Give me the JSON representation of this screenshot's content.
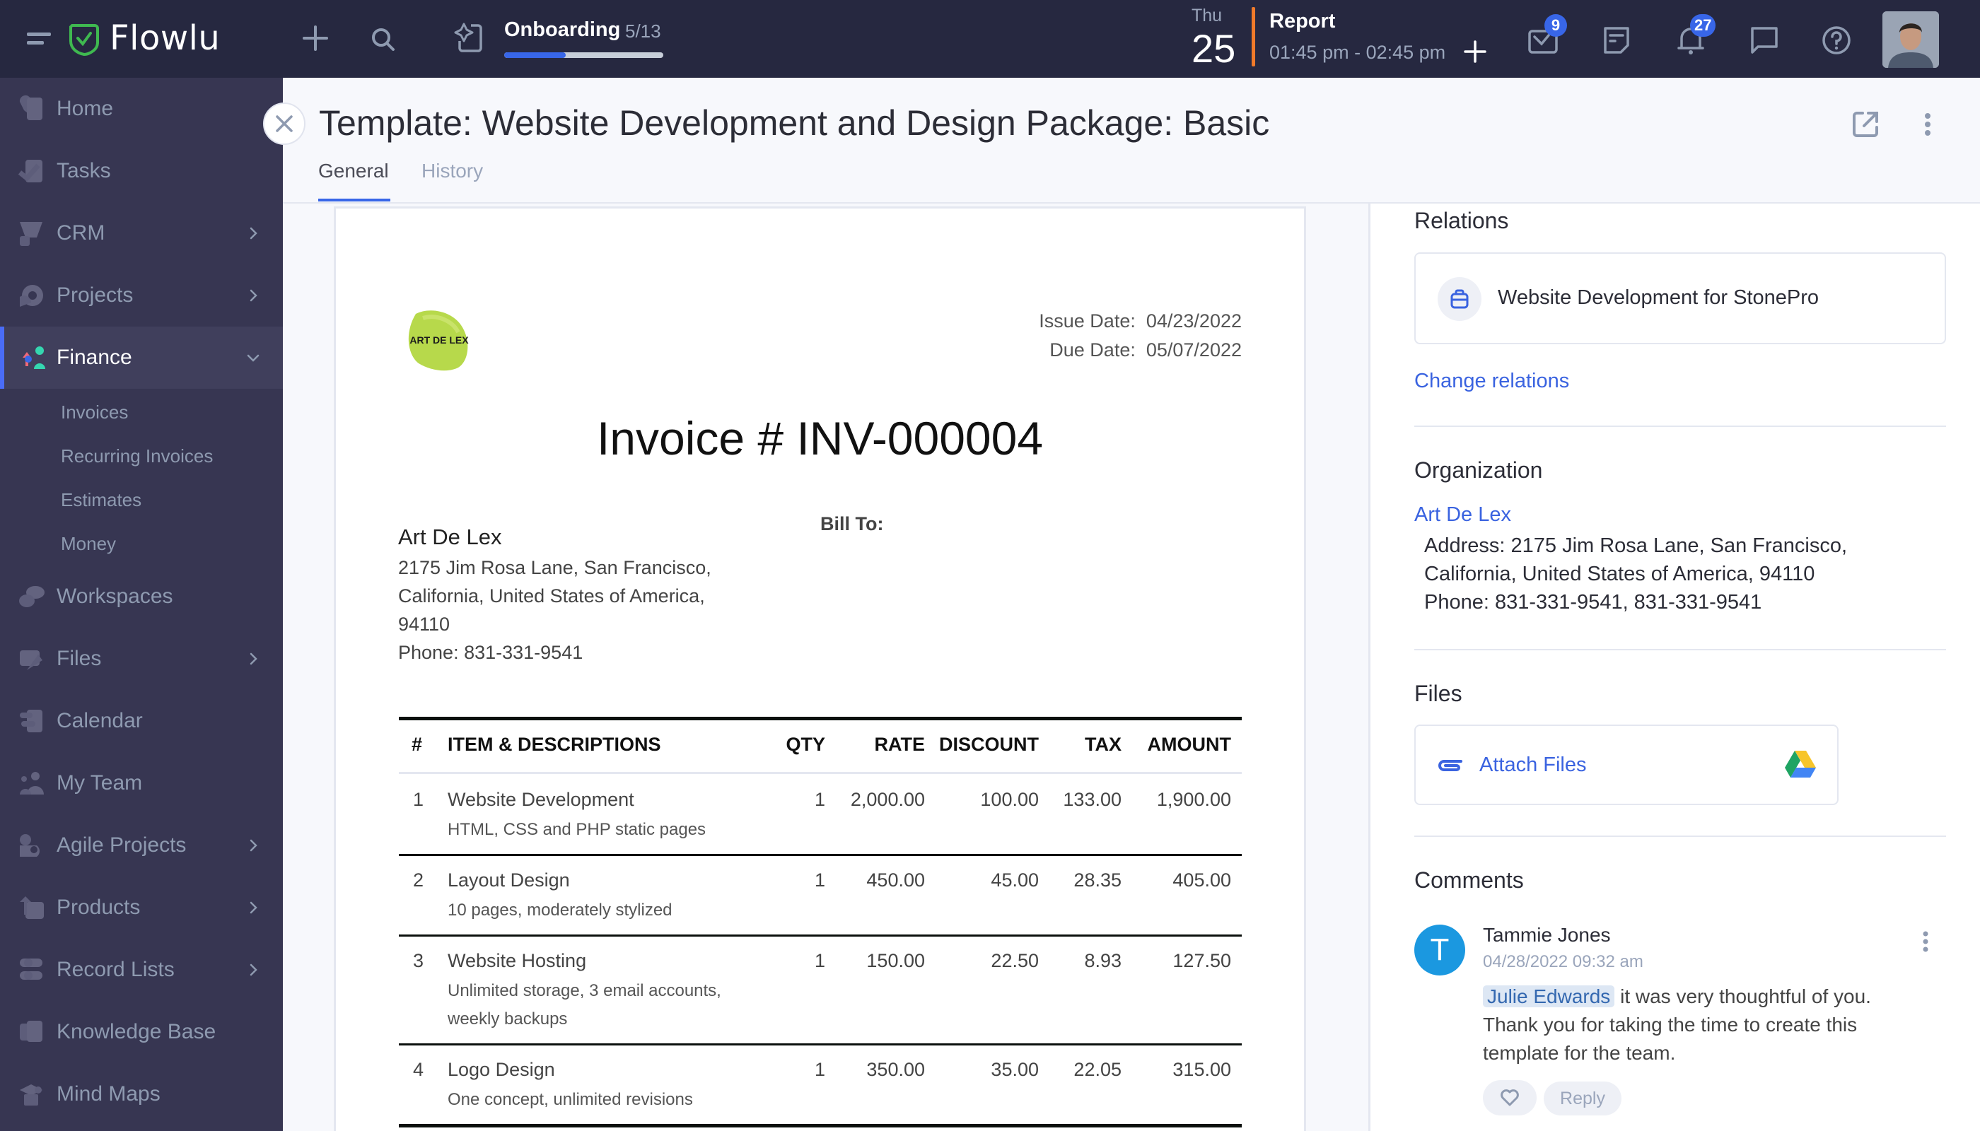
{
  "topbar": {
    "app_name": "Flowlu",
    "onboarding": {
      "label": "Onboarding",
      "count": "5/13",
      "progress": 0.385
    },
    "calendar": {
      "day": "Thu",
      "date": "25"
    },
    "event": {
      "title": "Report",
      "time": "01:45 pm - 02:45 pm"
    },
    "badges": {
      "mail": "9",
      "notifications": "27"
    },
    "colors": {
      "bg": "#262840",
      "accent": "#3866e8",
      "event_bar": "#f07a2a"
    }
  },
  "sidebar": {
    "items": [
      {
        "label": "Home",
        "icon": "home-icon",
        "chevron": false
      },
      {
        "label": "Tasks",
        "icon": "tasks-icon",
        "chevron": false
      },
      {
        "label": "CRM",
        "icon": "crm-icon",
        "chevron": true
      },
      {
        "label": "Projects",
        "icon": "projects-icon",
        "chevron": true
      },
      {
        "label": "Finance",
        "icon": "finance-icon",
        "chevron": "down",
        "active": true
      },
      {
        "label": "Workspaces",
        "icon": "workspaces-icon",
        "chevron": false
      },
      {
        "label": "Files",
        "icon": "files-icon",
        "chevron": true
      },
      {
        "label": "Calendar",
        "icon": "calendar-icon",
        "chevron": false
      },
      {
        "label": "My Team",
        "icon": "team-icon",
        "chevron": false
      },
      {
        "label": "Agile Projects",
        "icon": "agile-icon",
        "chevron": true
      },
      {
        "label": "Products",
        "icon": "products-icon",
        "chevron": true
      },
      {
        "label": "Record Lists",
        "icon": "record-lists-icon",
        "chevron": true
      },
      {
        "label": "Knowledge Base",
        "icon": "knowledge-base-icon",
        "chevron": false
      },
      {
        "label": "Mind Maps",
        "icon": "mind-maps-icon",
        "chevron": false
      }
    ],
    "finance_sub": [
      "Invoices",
      "Recurring Invoices",
      "Estimates",
      "Money"
    ]
  },
  "header": {
    "title": "Template: Website Development and Design Package: Basic",
    "tabs": [
      {
        "label": "General",
        "active": true
      },
      {
        "label": "History",
        "active": false
      }
    ]
  },
  "invoice": {
    "logo_text": "ART DE LEX",
    "issue_date_label": "Issue Date:",
    "issue_date": "04/23/2022",
    "due_date_label": "Due Date:",
    "due_date": "05/07/2022",
    "number": "Invoice # INV-000004",
    "from": {
      "name": "Art De Lex",
      "lines": [
        "2175 Jim Rosa Lane, San Francisco,",
        "California, United States of America,",
        "94110",
        "Phone: 831-331-9541"
      ]
    },
    "bill_to_label": "Bill To:",
    "columns": [
      "#",
      "ITEM & DESCRIPTIONS",
      "QTY",
      "RATE",
      "DISCOUNT",
      "TAX",
      "AMOUNT"
    ],
    "rows": [
      {
        "num": "1",
        "item": "Website Development",
        "desc": [
          "HTML, CSS and PHP static pages"
        ],
        "qty": "1",
        "rate": "2,000.00",
        "discount": "100.00",
        "tax": "133.00",
        "amount": "1,900.00"
      },
      {
        "num": "2",
        "item": "Layout Design",
        "desc": [
          "10 pages, moderately stylized"
        ],
        "qty": "1",
        "rate": "450.00",
        "discount": "45.00",
        "tax": "28.35",
        "amount": "405.00"
      },
      {
        "num": "3",
        "item": "Website Hosting",
        "desc": [
          "Unlimited storage, 3 email accounts,",
          "weekly backups"
        ],
        "qty": "1",
        "rate": "150.00",
        "discount": "22.50",
        "tax": "8.93",
        "amount": "127.50"
      },
      {
        "num": "4",
        "item": "Logo Design",
        "desc": [
          "One concept, unlimited revisions"
        ],
        "qty": "1",
        "rate": "350.00",
        "discount": "35.00",
        "tax": "22.05",
        "amount": "315.00"
      }
    ]
  },
  "right_panel": {
    "relations": {
      "title": "Relations",
      "item": "Website Development for StonePro",
      "change_link": "Change relations"
    },
    "organization": {
      "title": "Organization",
      "name": "Art De Lex",
      "lines": [
        "Address: 2175 Jim Rosa Lane, San Francisco,",
        "California, United States of America, 94110",
        "Phone: 831-331-9541, 831-331-9541"
      ]
    },
    "files": {
      "title": "Files",
      "attach_label": "Attach Files"
    },
    "comments": {
      "title": "Comments",
      "items": [
        {
          "initial": "T",
          "author": "Tammie Jones",
          "date": "04/28/2022 09:32 am",
          "mention": "Julie Edwards",
          "text": "it was very thoughtful of you. Thank you for taking the time to create this template for the team.",
          "reply_label": "Reply"
        }
      ]
    }
  }
}
